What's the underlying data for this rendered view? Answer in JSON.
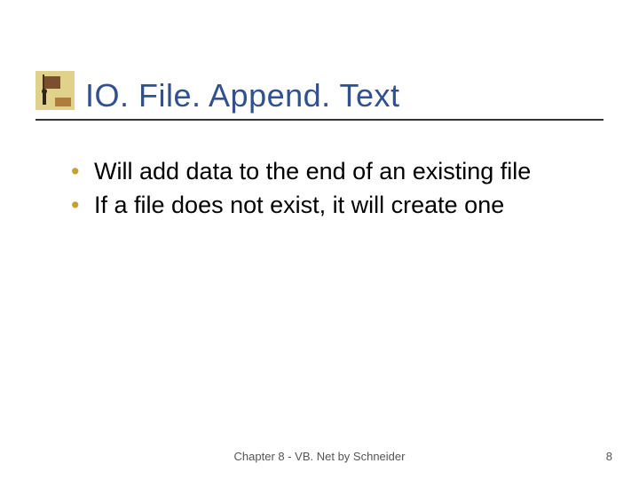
{
  "slide": {
    "title": "IO. File. Append. Text",
    "bullets": [
      "Will add data to the end of an existing file",
      "If a file does not exist, it will create one"
    ],
    "footer_center": "Chapter 8 - VB. Net by Schneider",
    "page_number": "8"
  }
}
